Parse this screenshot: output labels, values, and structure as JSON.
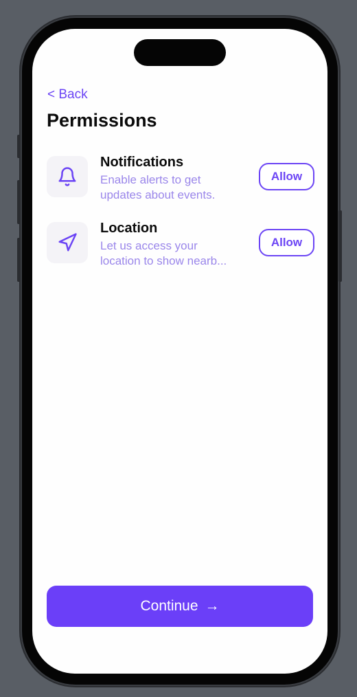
{
  "nav": {
    "back_label": "< Back"
  },
  "page": {
    "title": "Permissions"
  },
  "permissions": [
    {
      "icon": "bell-icon",
      "title": "Notifications",
      "desc_line1": "Enable alerts to get",
      "desc_line2": "updates about events.",
      "action": "Allow"
    },
    {
      "icon": "navigation-arrow-icon",
      "title": "Location",
      "desc_line1": "Let us access your",
      "desc_line2": "location to show nearb...",
      "action": "Allow"
    }
  ],
  "footer": {
    "continue_label": "Continue",
    "continue_arrow": "→"
  },
  "colors": {
    "accent": "#6b3ff8",
    "text": "#0b0b0b",
    "muted": "#9a86ea"
  }
}
